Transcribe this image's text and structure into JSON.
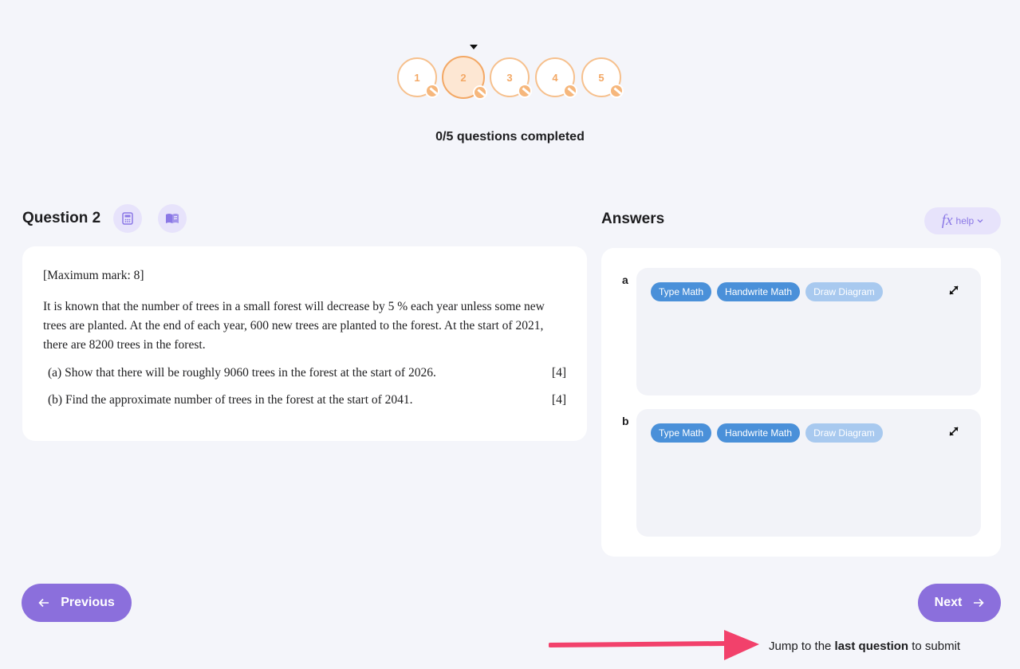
{
  "progress": {
    "steps": [
      "1",
      "2",
      "3",
      "4",
      "5"
    ],
    "current_step": 2,
    "completed": 0,
    "total": 5,
    "status_text": "0/5 questions completed"
  },
  "question": {
    "title": "Question 2",
    "tools": [
      "calculator-icon",
      "book-icon"
    ],
    "max_mark": "[Maximum mark: 8]",
    "body": "It is known that the number of trees in a small forest will decrease by 5 % each year unless some new trees are planted. At the end of each year, 600 new trees are planted to the forest. At the start of 2021, there are 8200 trees in the forest.",
    "parts": [
      {
        "text": "(a) Show that there will be roughly 9060 trees in the forest at the start of 2026.",
        "marks": "[4]"
      },
      {
        "text": "(b) Find the approximate number of trees in the forest at the start of 2041.",
        "marks": "[4]"
      }
    ]
  },
  "answers": {
    "title": "Answers",
    "help_label": "help",
    "fx_symbol": "fx",
    "items": [
      {
        "label": "a",
        "modes": [
          "Type Math",
          "Handwrite Math",
          "Draw Diagram"
        ]
      },
      {
        "label": "b",
        "modes": [
          "Type Math",
          "Handwrite Math",
          "Draw Diagram"
        ]
      }
    ]
  },
  "navigation": {
    "previous_label": "Previous",
    "next_label": "Next",
    "jump_prefix": "Jump to the ",
    "jump_bold": "last question",
    "jump_suffix": " to submit"
  },
  "colors": {
    "accent": "#8b6fdc",
    "step_orange": "#f3a865",
    "chip_blue": "#4a90d9",
    "annotation_arrow": "#f2416b"
  }
}
